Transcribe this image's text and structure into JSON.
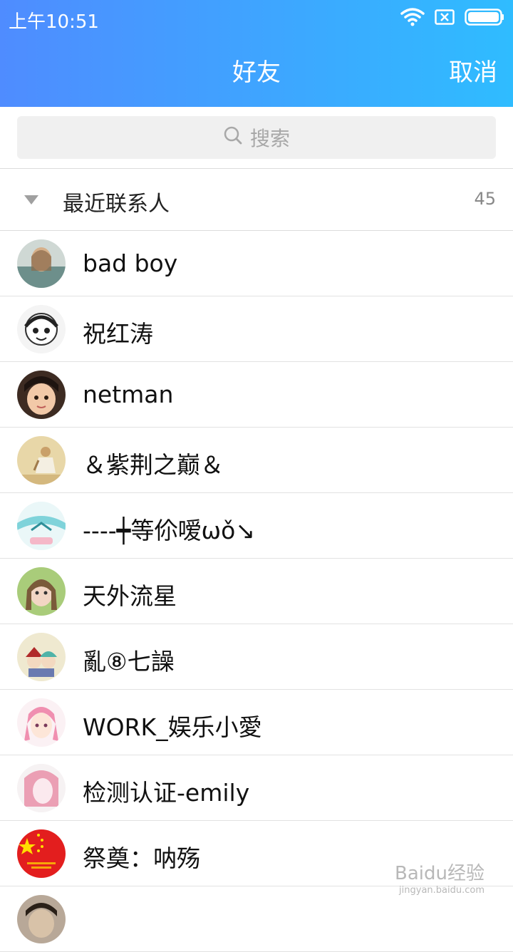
{
  "status_bar": {
    "time": "上午10:51",
    "icons": [
      "wifi-icon",
      "sim-x-icon",
      "battery-icon"
    ]
  },
  "nav": {
    "title": "好友",
    "cancel_label": "取消"
  },
  "search": {
    "placeholder": "搜索",
    "icon": "search-icon"
  },
  "group": {
    "title": "最近联系人",
    "count": "45",
    "icon": "triangle-down-icon"
  },
  "contacts": [
    {
      "name": "bad boy",
      "avatar_color": "#7fa3a8"
    },
    {
      "name": "祝红涛",
      "avatar_color": "#e8e8e8"
    },
    {
      "name": "netman",
      "avatar_color": "#6b4e3d"
    },
    {
      "name": "＆紫荆之巅＆",
      "avatar_color": "#e3d2a3"
    },
    {
      "name": "----┿等伱嗳ωǒ↘",
      "avatar_color": "#bfe9ec"
    },
    {
      "name": "天外流星",
      "avatar_color": "#9bc26b"
    },
    {
      "name": "亂⑧七譟",
      "avatar_color": "#e9e4c8"
    },
    {
      "name": "WORK_娱乐小愛",
      "avatar_color": "#f7dce6"
    },
    {
      "name": "检测认证-emily",
      "avatar_color": "#f1b8c6"
    },
    {
      "name": "祭奠：呐殇",
      "avatar_color": "#e41f1f"
    },
    {
      "name": "",
      "avatar_color": "#8a7a6a"
    }
  ],
  "watermark": {
    "text": "Baidu经验",
    "sub": "jingyan.baidu.com"
  }
}
